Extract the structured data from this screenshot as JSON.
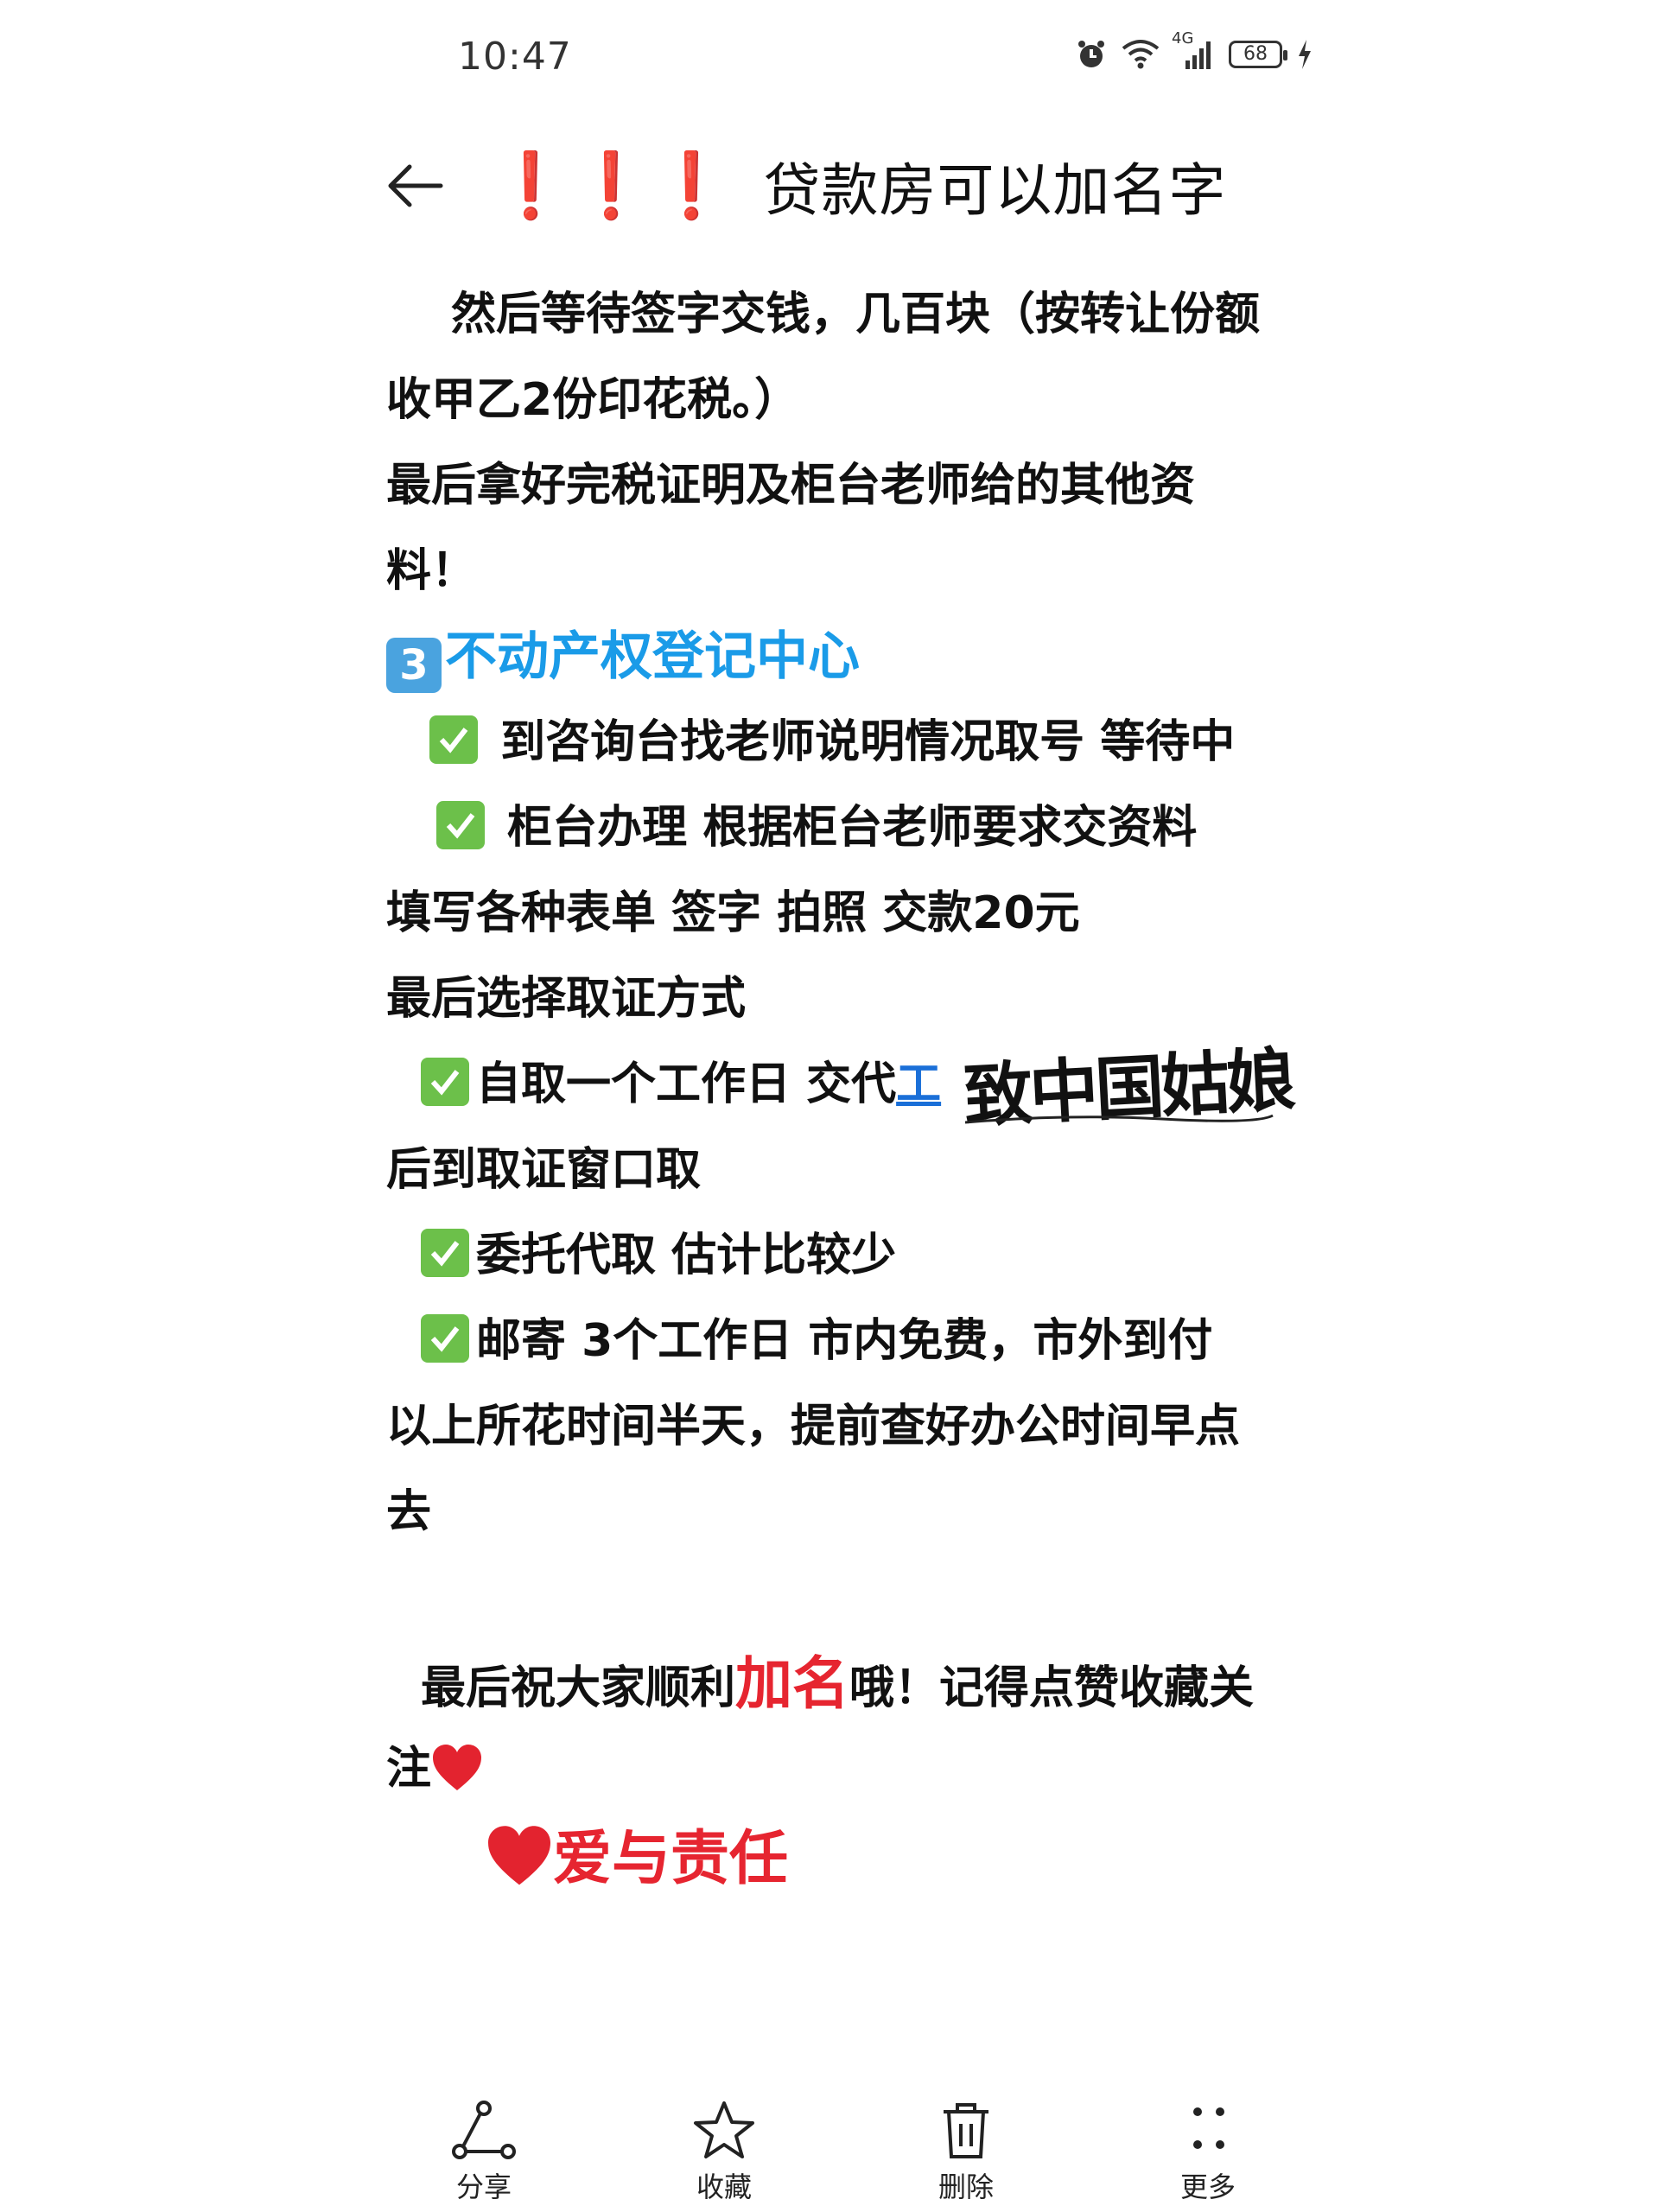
{
  "status": {
    "time": "10:47",
    "network": "4G",
    "battery": "68"
  },
  "header": {
    "title_marks": "❗❗❗",
    "title": "贷款房可以加名字"
  },
  "content": {
    "p1a": "然后等待签字交钱，几百块（按转让份额",
    "p1b": "收甲乙2份印花税。）",
    "p2a": "最后拿好完税证明及柜台老师给的其他资",
    "p2b": "料！",
    "section_num": "3",
    "section_title": "不动产权登记中心",
    "c1": " 到咨询台找老师说明情况取号   等待中",
    "c2": "  柜台办理    根据柜台老师要求交资料",
    "p3": "填写各种表单  签字 拍照  交款20元",
    "p4": "最后选择取证方式",
    "c3a": "自取一个工作日  交代",
    "c3b": "工",
    "p5": "后到取证窗口取",
    "c4": "委托代取 估计比较少",
    "c5": "邮寄  3个工作日 市内免费，市外到付",
    "p6a": "以上所花时间半天，提前查好办公时间早点",
    "p6b": "去",
    "closing_a": "最后祝大家顺利",
    "closing_highlight": "加名",
    "closing_b": "哦！记得点赞收藏关",
    "closing_c": "注",
    "signoff": "爱与责任"
  },
  "watermark": "致中国姑娘",
  "bottom_actions": [
    {
      "label": "分享",
      "icon": "share-icon"
    },
    {
      "label": "收藏",
      "icon": "star-icon"
    },
    {
      "label": "删除",
      "icon": "trash-icon"
    },
    {
      "label": "更多",
      "icon": "more-icon"
    }
  ],
  "colors": {
    "accent_blue": "#1a9be8",
    "accent_red": "#e62530",
    "check_green": "#6cc04a"
  }
}
